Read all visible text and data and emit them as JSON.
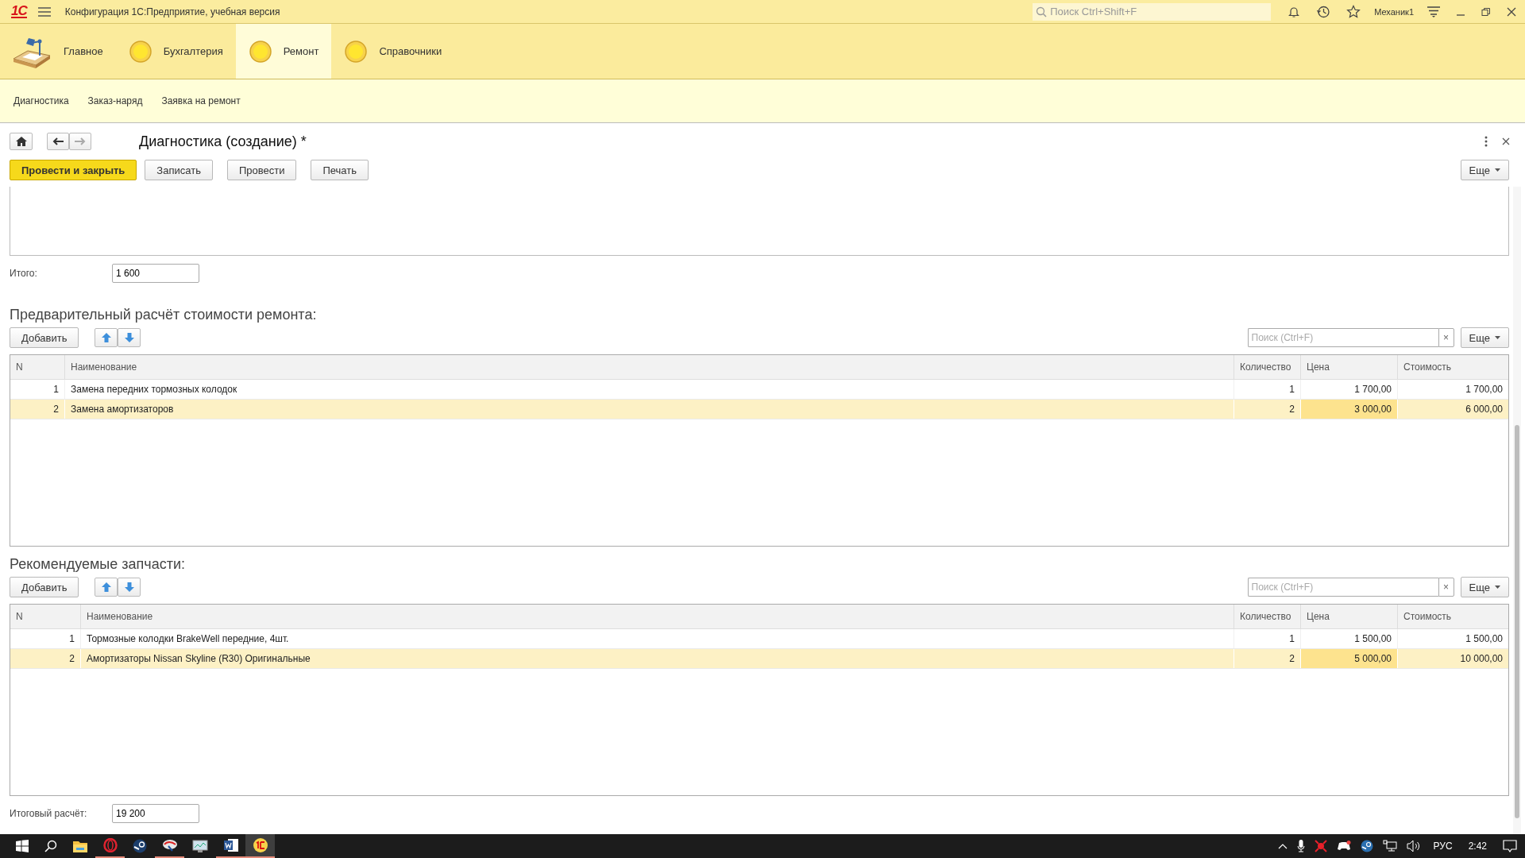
{
  "app_bar": {
    "logo": "1С",
    "title": "Конфигурация 1С:Предприятие, учебная версия",
    "search": {
      "placeholder": "Поиск Ctrl+Shift+F"
    },
    "user": "Механик1"
  },
  "sections": [
    {
      "label": "Главное",
      "kind": "desk",
      "selected": false
    },
    {
      "label": "Бухгалтерия",
      "kind": "circle",
      "selected": false
    },
    {
      "label": "Ремонт",
      "kind": "circle",
      "selected": true
    },
    {
      "label": "Справочники",
      "kind": "circle",
      "selected": false
    }
  ],
  "subnav": [
    "Диагностика",
    "Заказ-наряд",
    "Заявка на ремонт"
  ],
  "form": {
    "title": "Диагностика (создание) *",
    "commands": [
      {
        "label": "Провести и закрыть",
        "kind": "primary"
      },
      {
        "label": "Записать",
        "kind": "normal"
      },
      {
        "label": "Провести",
        "kind": "normal"
      },
      {
        "label": "Печать",
        "kind": "normal"
      }
    ],
    "more": "Еще",
    "total": {
      "label": "Итого:",
      "value": "1 600"
    },
    "tables": [
      {
        "heading": "Предварительный расчёт стоимости ремонта:",
        "add": "Добавить",
        "search": {
          "placeholder": "Поиск (Ctrl+F)",
          "clear": "×"
        },
        "more": "Еще",
        "columns": [
          {
            "label": "N",
            "kind": "number"
          },
          {
            "label": "Наименование",
            "kind": "text"
          },
          {
            "label": "Количество",
            "kind": "number"
          },
          {
            "label": "Цена",
            "kind": "number"
          },
          {
            "label": "Стоимость",
            "kind": "number"
          }
        ],
        "rows": [
          {
            "selected": false,
            "cells": [
              {
                "text": "1",
                "focused": false
              },
              {
                "text": "Замена передних тормозных колодок",
                "focused": false
              },
              {
                "text": "1",
                "focused": false
              },
              {
                "text": "1 700,00",
                "focused": false
              },
              {
                "text": "1 700,00",
                "focused": false
              }
            ]
          },
          {
            "selected": true,
            "cells": [
              {
                "text": "2",
                "focused": false
              },
              {
                "text": "Замена амортизаторов",
                "focused": false
              },
              {
                "text": "2",
                "focused": false
              },
              {
                "text": "3 000,00",
                "focused": true
              },
              {
                "text": "6 000,00",
                "focused": false
              }
            ]
          }
        ]
      },
      {
        "heading": "Рекомендуемые запчасти:",
        "add": "Добавить",
        "search": {
          "placeholder": "Поиск (Ctrl+F)",
          "clear": "×"
        },
        "more": "Еще",
        "columns": [
          {
            "label": "N",
            "kind": "number"
          },
          {
            "label": "Наименование",
            "kind": "text"
          },
          {
            "label": "Количество",
            "kind": "number"
          },
          {
            "label": "Цена",
            "kind": "number"
          },
          {
            "label": "Стоимость",
            "kind": "number"
          }
        ],
        "rows": [
          {
            "selected": false,
            "cells": [
              {
                "text": "1",
                "focused": false
              },
              {
                "text": "Тормозные колодки BrakeWell передние, 4шт.",
                "focused": false
              },
              {
                "text": "1",
                "focused": false
              },
              {
                "text": "1 500,00",
                "focused": false
              },
              {
                "text": "1 500,00",
                "focused": false
              }
            ]
          },
          {
            "selected": true,
            "cells": [
              {
                "text": "2",
                "focused": false
              },
              {
                "text": "Амортизаторы Nissan Skyline (R30) Оригинальные",
                "focused": false
              },
              {
                "text": "2",
                "focused": false
              },
              {
                "text": "5 000,00",
                "focused": true
              },
              {
                "text": "10 000,00",
                "focused": false
              }
            ]
          }
        ]
      }
    ],
    "grand_total": {
      "label": "Итоговый расчёт:",
      "value": "19 200"
    }
  },
  "taskbar": {
    "language": "РУС",
    "time": "2:42"
  }
}
